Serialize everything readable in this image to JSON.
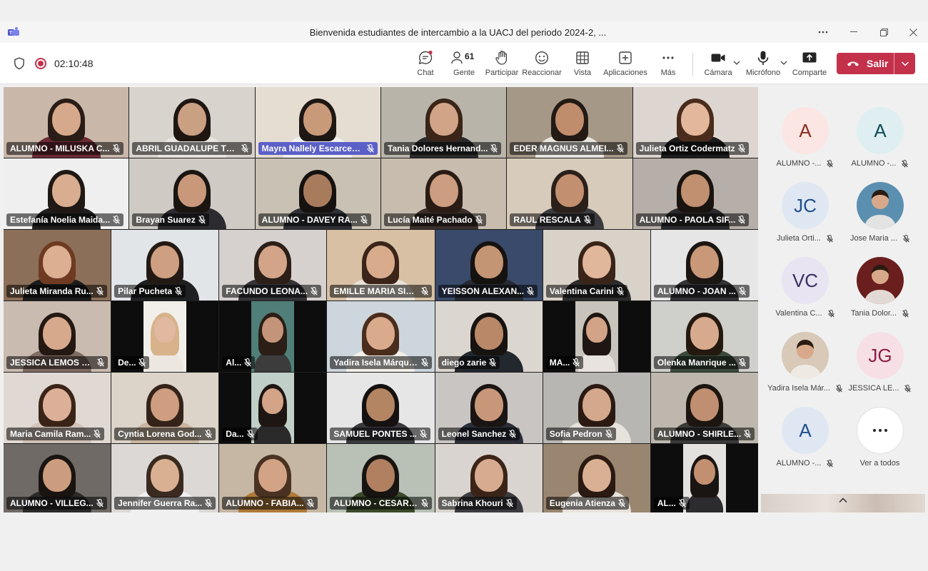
{
  "window": {
    "title": "Bienvenida estudiantes de intercambio a la UACJ del periodo 2024-2, ...",
    "more_icon": "ellipsis-icon",
    "minimize_icon": "minimize-icon",
    "restore_icon": "restore-icon",
    "close_icon": "close-icon"
  },
  "toolbar": {
    "timer": "02:10:48",
    "chat": "Chat",
    "people_count": "61",
    "people": "Gente",
    "raise_hand": "Participar",
    "react": "Reaccionar",
    "view": "Vista",
    "apps": "Aplicaciones",
    "more": "Más",
    "camera": "Cámara",
    "mic": "Micrófono",
    "share": "Comparte",
    "leave": "Salir"
  },
  "colors": {
    "leave_red": "#c4314b",
    "highlight_purple": "#5b5fc7",
    "recording": "#c4314b"
  },
  "grid": {
    "tiles": [
      {
        "name": "ALUMNO - MILUSKA C...",
        "bg": "#c9b7a9",
        "skin": "#d7a98c",
        "hair": "#2a1d17",
        "shirt": "#6b2a35"
      },
      {
        "name": "ABRIL GUADALUPE TRI...",
        "bg": "#d9d3cd",
        "skin": "#caa083",
        "hair": "#1f1612",
        "shirt": "#e8e4e0"
      },
      {
        "name": "Mayra Nallely Escarcega ...",
        "bg": "#e6ddd2",
        "skin": "#c99a7a",
        "hair": "#1d1814",
        "shirt": "#f0f0f0",
        "highlight": true
      },
      {
        "name": "Tania Dolores Hernand...",
        "bg": "#b9b4aa",
        "skin": "#d2a487",
        "hair": "#3a2518",
        "shirt": "#2a2a2a"
      },
      {
        "name": "EDER MAGNUS ALMEI...",
        "bg": "#a59887",
        "skin": "#c08d6c",
        "hair": "#231a14",
        "shirt": "#e8e4de"
      },
      {
        "name": "Julieta Ortiz Codermatz",
        "bg": "#ddd5cf",
        "skin": "#e2b79b",
        "hair": "#4a2c1c",
        "shirt": "#1c1c1c"
      },
      {
        "name": "Estefanía Noelia Maida...",
        "bg": "#efefef",
        "skin": "#d8ad90",
        "hair": "#1f1814",
        "shirt": "#1f1f1f"
      },
      {
        "name": "Brayan Suarez",
        "bg": "#cfcac4",
        "skin": "#c9977a",
        "hair": "#1b1512",
        "shirt": "#2c2c30"
      },
      {
        "name": "ALUMNO - DAVEY RA...",
        "bg": "#c8c1b4",
        "skin": "#a97b5d",
        "hair": "#151210",
        "shirt": "#2f3136"
      },
      {
        "name": "Lucía Maité Pachado",
        "bg": "#c7bcae",
        "skin": "#cc9d80",
        "hair": "#2a1c14",
        "shirt": "#3a2f2a"
      },
      {
        "name": "RAUL RESCALA",
        "bg": "#d7cbbb",
        "skin": "#c28f70",
        "hair": "#2b201a",
        "shirt": "#3b3b40"
      },
      {
        "name": "ALUMNO - PAOLA SIF...",
        "bg": "#b6aea8",
        "skin": "#c09070",
        "hair": "#1a1410",
        "shirt": "#2a2a2e"
      },
      {
        "name": "Julieta Miranda Ru...",
        "bg": "#8c6f58",
        "skin": "#dcae92",
        "hair": "#6e3b22",
        "shirt": "#1c1c1c"
      },
      {
        "name": "Pilar Pucheta",
        "bg": "#e2e5e8",
        "skin": "#cf9f82",
        "hair": "#241a15",
        "shirt": "#1f2022"
      },
      {
        "name": "FACUNDO LEONA...",
        "bg": "#d6d1cf",
        "skin": "#d3a488",
        "hair": "#2b1f18",
        "shirt": "#343438"
      },
      {
        "name": "EMILLE MARIA SIL...",
        "bg": "#d8c0a4",
        "skin": "#d9ab8d",
        "hair": "#3b2418",
        "shirt": "#e9e1d6"
      },
      {
        "name": "YEISSON ALEXAN...",
        "bg": "#3a4a6a",
        "skin": "#c49574",
        "hair": "#161210",
        "shirt": "#262a33"
      },
      {
        "name": "Valentina Carini",
        "bg": "#d9d2c8",
        "skin": "#e0b79b",
        "hair": "#3a2418",
        "shirt": "#2b2b2b"
      },
      {
        "name": "ALUMNO - JOAN ...",
        "bg": "#e6e6e6",
        "skin": "#c89878",
        "hair": "#1c1612",
        "shirt": "#323236"
      },
      {
        "name": "JESSICA LEMOS G...",
        "bg": "#c9bbb0",
        "skin": "#d6a98d",
        "hair": "#241912",
        "shirt": "#7e6b62"
      },
      {
        "name": "De...",
        "bg": "#f2efea",
        "skin": "#e1b9a0",
        "hair": "#d7b28a",
        "shirt": "#ece7e0",
        "letterbox": true
      },
      {
        "name": "Al...",
        "bg": "#4f7f78",
        "skin": "#c4947a",
        "hair": "#2a1e16",
        "shirt": "#3c3c3c",
        "letterbox": true
      },
      {
        "name": "Yadira Isela Márquez...",
        "bg": "#cdd6dc",
        "skin": "#d9aa8c",
        "hair": "#4a2d1c",
        "shirt": "#f2efe9"
      },
      {
        "name": "diego zarie",
        "bg": "#dbd6d0",
        "skin": "#b88868",
        "hair": "#171310",
        "shirt": "#23272e"
      },
      {
        "name": "MA...",
        "bg": "#c8c3bb",
        "skin": "#d2a386",
        "hair": "#1e1612",
        "shirt": "#e8e3de",
        "letterbox": true
      },
      {
        "name": "Olenka Manrique ...",
        "bg": "#cfcfcb",
        "skin": "#d8aa8d",
        "hair": "#24190f",
        "shirt": "#3a4a3a"
      },
      {
        "name": "Maria Camila Ram...",
        "bg": "#e0d8d2",
        "skin": "#dcb098",
        "hair": "#3a2418",
        "shirt": "#d0c2b8"
      },
      {
        "name": "Cyntia Lorena God...",
        "bg": "#dcd4c8",
        "skin": "#cf9e80",
        "hair": "#35231a",
        "shirt": "#c9b5a0"
      },
      {
        "name": "Da...",
        "bg": "#c0cfc7",
        "skin": "#d3a487",
        "hair": "#1e1612",
        "shirt": "#2a2a2a",
        "letterbox": true
      },
      {
        "name": "SAMUEL PONTES ...",
        "bg": "#e6e6e6",
        "skin": "#b48563",
        "hair": "#141110",
        "shirt": "#3a3a3e"
      },
      {
        "name": "Leonel Sanchez",
        "bg": "#c9c5c3",
        "skin": "#c8977a",
        "hair": "#1a1512",
        "shirt": "#2a2e38"
      },
      {
        "name": "Sofia Pedron",
        "bg": "#b8b6b2",
        "skin": "#d4a88c",
        "hair": "#2a1a12",
        "shirt": "#e6e2dc"
      },
      {
        "name": "ALUMNO - SHIRLE...",
        "bg": "#bdb7ad",
        "skin": "#c08e70",
        "hair": "#1c1510",
        "shirt": "#3a3a3a"
      },
      {
        "name": "ALUMNO - VILLEG...",
        "bg": "#6f6a66",
        "skin": "#cc9c7e",
        "hair": "#1a1411",
        "shirt": "#2a2a2a"
      },
      {
        "name": "Jennifer Guerra Ra...",
        "bg": "#dcd8d6",
        "skin": "#dab092",
        "hair": "#3a2a20",
        "shirt": "#efefef"
      },
      {
        "name": "ALUMNO - FABIA...",
        "bg": "#c5b7a4",
        "skin": "#d2a385",
        "hair": "#4a3222",
        "shirt": "#b07a3a"
      },
      {
        "name": "ALUMNO - CESAR ...",
        "bg": "#b9c0b6",
        "skin": "#b08060",
        "hair": "#181411",
        "shirt": "#3c4a2c"
      },
      {
        "name": "Sabrina Khouri",
        "bg": "#d9d4cf",
        "skin": "#d7ab90",
        "hair": "#3a2418",
        "shirt": "#3c3c40"
      },
      {
        "name": "Eugenia Atienza",
        "bg": "#9a8670",
        "skin": "#dab094",
        "hair": "#2a1a12",
        "shirt": "#e8e2dc"
      },
      {
        "name": "AL...",
        "bg": "#e4e2de",
        "skin": "#c28f70",
        "hair": "#1a1512",
        "shirt": "#2c2c2e",
        "letterbox": true
      }
    ]
  },
  "roster": {
    "people": [
      {
        "initials": "A",
        "name": "ALUMNO -...",
        "bg": "#fbe6e3",
        "fg": "#8a2e21"
      },
      {
        "initials": "A",
        "name": "ALUMNO -...",
        "bg": "#dfeef0",
        "fg": "#0f4d57"
      },
      {
        "initials": "JC",
        "name": "Julieta Orti...",
        "bg": "#dfe7f3",
        "fg": "#1f4e8c"
      },
      {
        "initials": "",
        "name": "Jose Maria ...",
        "photo": true,
        "bg": "#5b8fb0"
      },
      {
        "initials": "VC",
        "name": "Valentina C...",
        "bg": "#e9e4f2",
        "fg": "#3b2f63"
      },
      {
        "initials": "",
        "name": "Tania Dolor...",
        "photo": true,
        "bg": "#6a1e1e"
      },
      {
        "initials": "",
        "name": "Yadira Isela Már...",
        "photo": true,
        "bg": "#d8c9b8"
      },
      {
        "initials": "JG",
        "name": "JESSICA LE...",
        "bg": "#f7dfe6",
        "fg": "#8a1f45"
      },
      {
        "initials": "A",
        "name": "ALUMNO -...",
        "bg": "#dfe7f3",
        "fg": "#1f4e8c"
      }
    ],
    "see_all": "Ver a todos"
  }
}
